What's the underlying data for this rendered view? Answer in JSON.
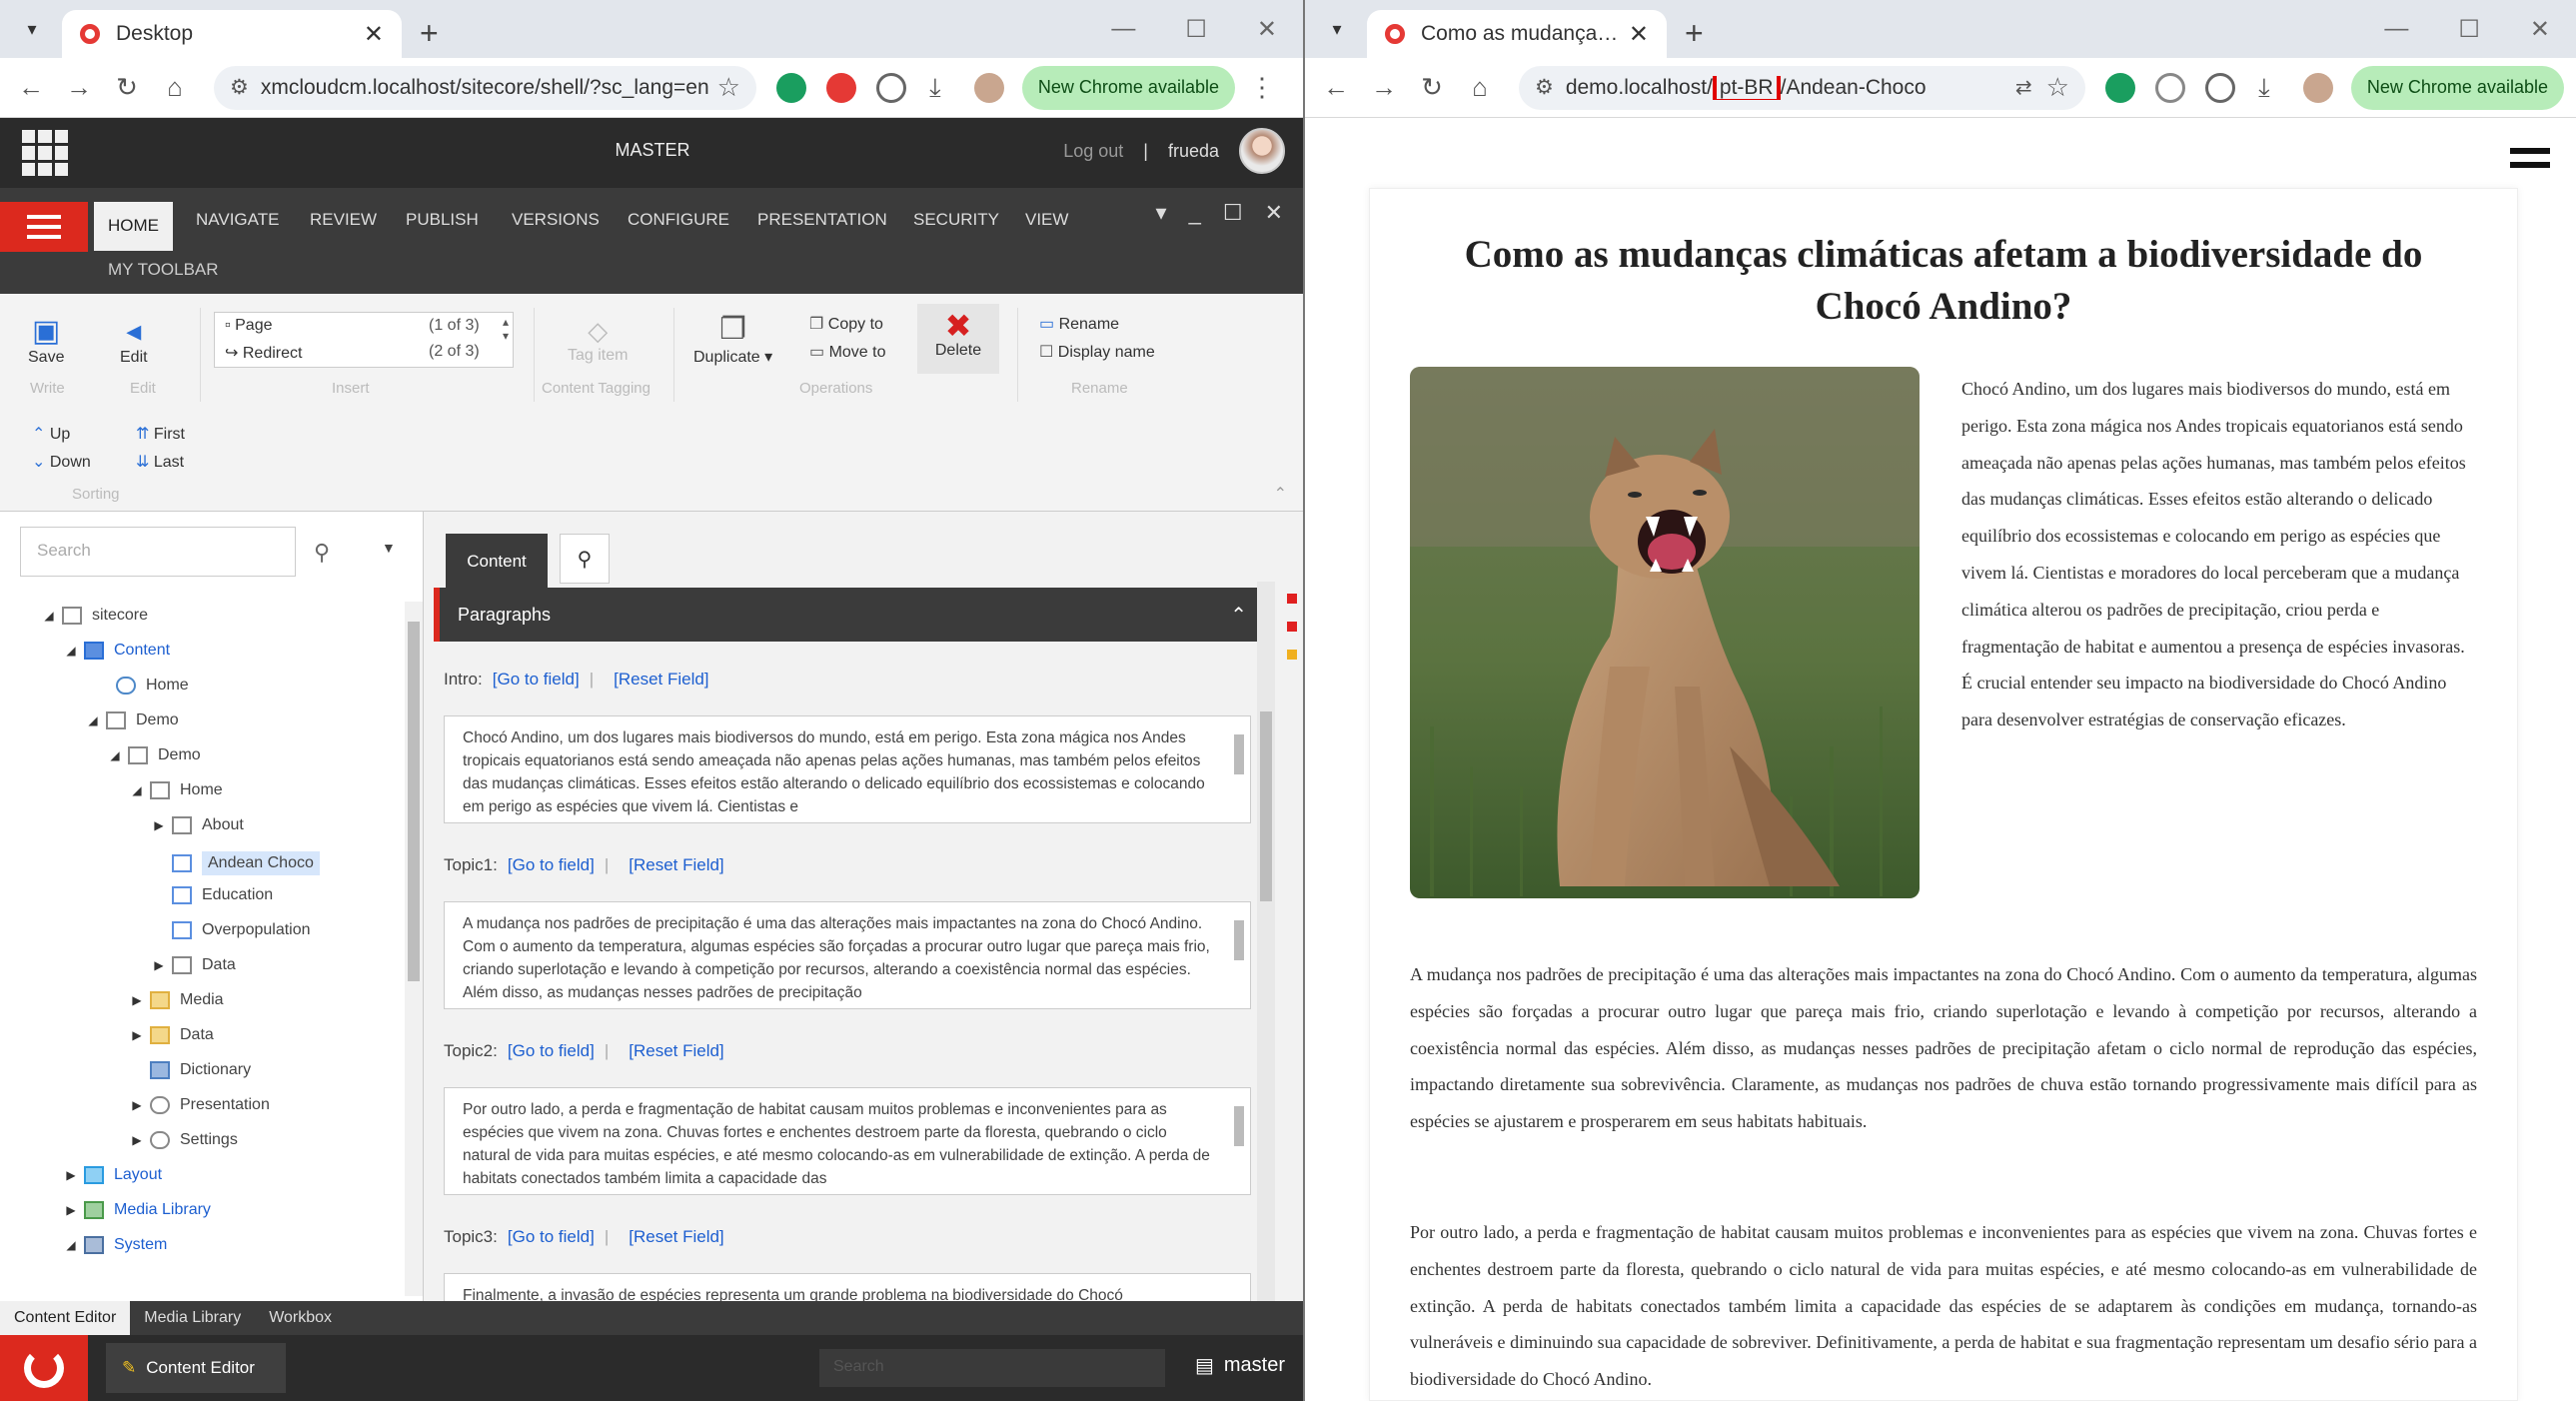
{
  "left_browser": {
    "tab_title": "Desktop",
    "url": "xmcloudcm.localhost/sitecore/shell/?sc_lang=en",
    "update_label": "New Chrome available"
  },
  "right_browser": {
    "tab_title": "Como as mudanças climáticas afetam",
    "url_prefix": "demo.localhost/",
    "url_lang": "pt-BR",
    "url_suffix": "/Andean-Choco",
    "update_label": "New Chrome available"
  },
  "sitecore": {
    "database": "MASTER",
    "logout": "Log out",
    "user": "frueda",
    "ribbon_tabs": [
      "HOME",
      "NAVIGATE",
      "REVIEW",
      "PUBLISH",
      "VERSIONS",
      "CONFIGURE",
      "PRESENTATION",
      "SECURITY",
      "VIEW"
    ],
    "my_toolbar": "MY TOOLBAR",
    "ribbon": {
      "save": "Save",
      "edit": "Edit",
      "write_group": "Write",
      "edit_group": "Edit",
      "page": "Page",
      "page_count": "(1 of 3)",
      "redirect": "Redirect",
      "redirect_count": "(2 of 3)",
      "insert_group": "Insert",
      "tag_item": "Tag item",
      "content_tagging_group": "Content Tagging",
      "duplicate": "Duplicate",
      "copy_to": "Copy to",
      "move_to": "Move to",
      "delete": "Delete",
      "operations_group": "Operations",
      "rename": "Rename",
      "display_name": "Display name",
      "rename_group": "Rename",
      "up": "Up",
      "down": "Down",
      "first": "First",
      "last": "Last",
      "sorting_group": "Sorting"
    },
    "search_placeholder": "Search",
    "tree": [
      "sitecore",
      "Content",
      "Home",
      "Demo",
      "Demo",
      "Home",
      "About",
      "Andean Choco",
      "Education",
      "Overpopulation",
      "Data",
      "Media",
      "Data",
      "Dictionary",
      "Presentation",
      "Settings",
      "Layout",
      "Media Library",
      "System"
    ],
    "content_tab": "Content",
    "section": "Paragraphs",
    "go_to_field": "[Go to field]",
    "reset_field": "[Reset Field]",
    "fields": [
      {
        "label": "Intro:",
        "text": "Chocó Andino, um dos lugares mais biodiversos do mundo, está em perigo. Esta zona mágica nos Andes tropicais equatorianos está sendo ameaçada não apenas pelas ações humanas, mas também pelos efeitos das mudanças climáticas. Esses efeitos estão alterando o delicado equilíbrio dos ecossistemas e colocando em perigo as espécies que vivem lá. Cientistas e"
      },
      {
        "label": "Topic1:",
        "text": "A mudança nos padrões de precipitação é uma das alterações mais impactantes na zona do Chocó Andino. Com o aumento da temperatura, algumas espécies são forçadas a procurar outro lugar que pareça mais frio, criando superlotação e levando à competição por recursos, alterando a coexistência normal das espécies. Além disso, as mudanças nesses padrões de precipitação"
      },
      {
        "label": "Topic2:",
        "text": "Por outro lado, a perda e fragmentação de habitat causam muitos problemas e inconvenientes para as espécies que vivem na zona. Chuvas fortes e enchentes destroem parte da floresta, quebrando o ciclo natural de vida para muitas espécies, e até mesmo colocando-as em vulnerabilidade de extinção. A perda de habitats conectados também limita a capacidade das"
      },
      {
        "label": "Topic3:",
        "text": "Finalmente, a invasão de espécies representa um grande problema na biodiversidade do Chocó"
      }
    ],
    "bottom_tabs": [
      "Content Editor",
      "Media Library",
      "Workbox"
    ],
    "taskbar_app": "Content Editor",
    "taskbar_search": "Search",
    "taskbar_db": "master",
    "colors": {
      "accent": "#dc291e",
      "dark": "#2b2b2b",
      "link": "#1d5fd0"
    }
  },
  "article": {
    "title": "Como as mudanças climáticas afetam a biodiversidade do Chocó Andino?",
    "intro": "Chocó Andino, um dos lugares mais biodiversos do mundo, está em perigo. Esta zona mágica nos Andes tropicais equatorianos está sendo ameaçada não apenas pelas ações humanas, mas também pelos efeitos das mudanças climáticas. Esses efeitos estão alterando o delicado equilíbrio dos ecossistemas e colocando em perigo as espécies que vivem lá. Cientistas e moradores do local perceberam que a mudança climática alterou os padrões de precipitação, criou perda e fragmentação de habitat e aumentou a presença de espécies invasoras. É crucial entender seu impacto na biodiversidade do Chocó Andino para desenvolver estratégias de conservação eficazes.",
    "topic1": "A mudança nos padrões de precipitação é uma das alterações mais impactantes na zona do Chocó Andino. Com o aumento da temperatura, algumas espécies são forçadas a procurar outro lugar que pareça mais frio, criando superlotação e levando à competição por recursos, alterando a coexistência normal das espécies. Além disso, as mudanças nesses padrões de precipitação afetam o ciclo normal de reprodução das espécies, impactando diretamente sua sobrevivência. Claramente, as mudanças nos padrões de chuva estão tornando progressivamente mais difícil para as espécies se ajustarem e prosperarem em seus habitats habituais.",
    "topic2": "Por outro lado, a perda e fragmentação de habitat causam muitos problemas e inconvenientes para as espécies que vivem na zona. Chuvas fortes e enchentes destroem parte da floresta, quebrando o ciclo natural de vida para muitas espécies, e até mesmo colocando-as em vulnerabilidade de extinção. A perda de habitats conectados também limita a capacidade das espécies de se adaptarem às condições em mudança, tornando-as vulneráveis e diminuindo sua capacidade de sobreviver. Definitivamente, a perda de habitat e sua fragmentação representam um desafio sério para a biodiversidade do Chocó Andino."
  }
}
